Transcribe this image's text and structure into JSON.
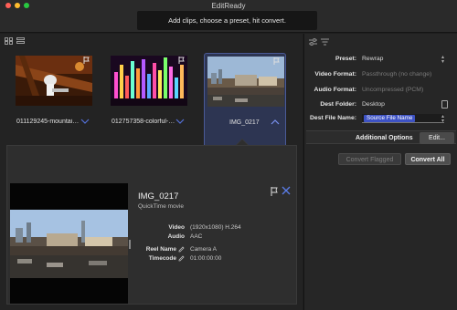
{
  "window": {
    "title": "EditReady"
  },
  "hint": "Add clips, choose a preset, hit convert.",
  "clips": [
    {
      "name": "011129245-mountain-bik...",
      "selected": false
    },
    {
      "name": "012757358-colorful-disc...",
      "selected": false
    },
    {
      "name": "IMG_0217",
      "selected": true
    }
  ],
  "detail": {
    "title": "IMG_0217",
    "subtitle": "QuickTime movie",
    "video_label": "Video",
    "video_value": "(1920x1080) H.264",
    "audio_label": "Audio",
    "audio_value": "AAC",
    "reel_label": "Reel Name",
    "reel_value": "Camera A",
    "timecode_label": "Timecode",
    "timecode_value": "01:00:00:00"
  },
  "settings": {
    "preset_label": "Preset:",
    "preset_value": "Rewrap",
    "video_format_label": "Video Format:",
    "video_format_value": "Passthrough (no change)",
    "audio_format_label": "Audio Format:",
    "audio_format_value": "Uncompressed (PCM)",
    "dest_folder_label": "Dest Folder:",
    "dest_folder_value": "Desktop",
    "dest_file_label": "Dest File Name:",
    "dest_file_token": "Source File Name"
  },
  "advanced": {
    "label": "Additional Options",
    "edit_button": "Edit..."
  },
  "actions": {
    "convert_flagged": "Convert Flagged",
    "convert_all": "Convert All"
  },
  "colors": {
    "accent": "#3d52c4",
    "selection": "#2d3552"
  }
}
